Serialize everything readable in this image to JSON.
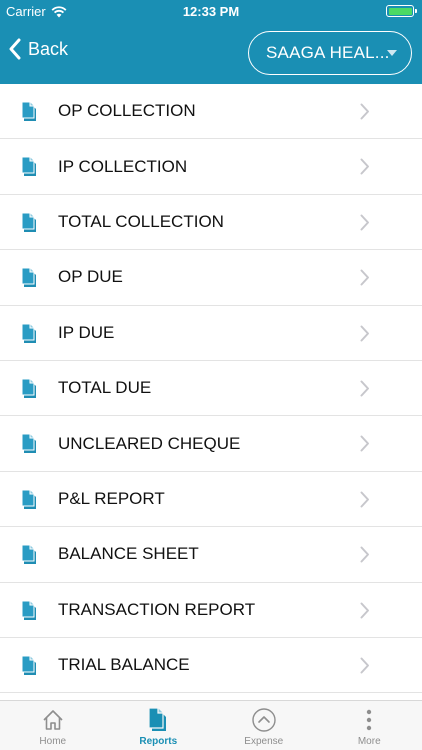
{
  "status": {
    "carrier": "Carrier",
    "time": "12:33 PM"
  },
  "header": {
    "back_label": "Back",
    "branch_selector": "SAAGA HEAL...",
    "accent_color": "#1a8fb4"
  },
  "reports": [
    {
      "label": "OP COLLECTION"
    },
    {
      "label": "IP COLLECTION"
    },
    {
      "label": "TOTAL COLLECTION"
    },
    {
      "label": "OP DUE"
    },
    {
      "label": "IP DUE"
    },
    {
      "label": "TOTAL DUE"
    },
    {
      "label": "UNCLEARED CHEQUE"
    },
    {
      "label": "P&L REPORT"
    },
    {
      "label": "BALANCE SHEET"
    },
    {
      "label": "TRANSACTION REPORT"
    },
    {
      "label": "TRIAL BALANCE"
    }
  ],
  "tabbar": {
    "tabs": [
      {
        "label": "Home",
        "icon": "home-icon",
        "active": false
      },
      {
        "label": "Reports",
        "icon": "document-icon",
        "active": true
      },
      {
        "label": "Expense",
        "icon": "chevron-up-circle-icon",
        "active": false
      },
      {
        "label": "More",
        "icon": "more-vertical-icon",
        "active": false
      }
    ]
  }
}
